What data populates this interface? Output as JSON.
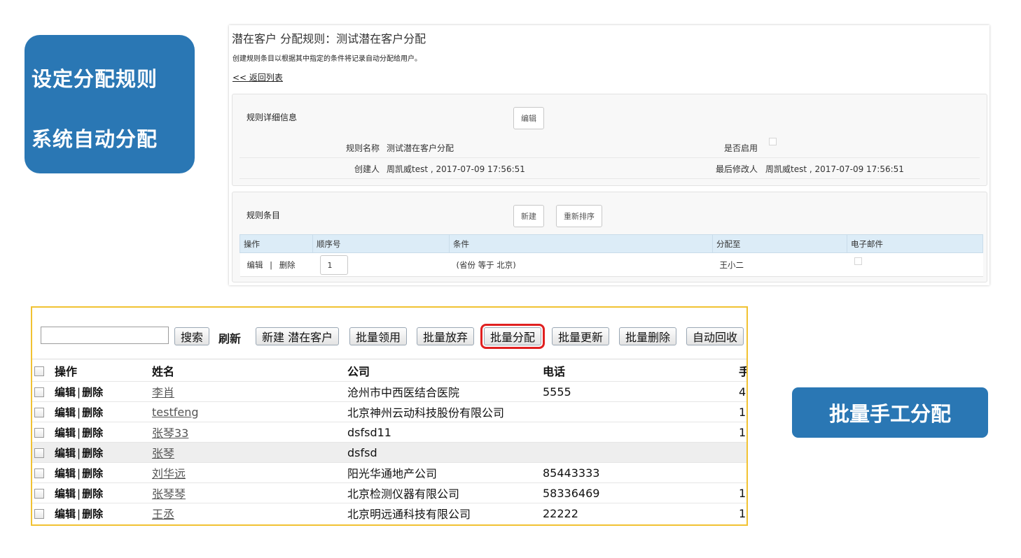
{
  "callouts": {
    "left_line1": "设定分配规则",
    "left_line2": "系统自动分配",
    "right": "批量手工分配"
  },
  "rule": {
    "title": "潜在客户 分配规则：测试潜在客户分配",
    "description": "创建规则条目以根据其中指定的条件将记录自动分配给用户。",
    "back_link": "<< 返回列表",
    "detail_section_title": "规则详细信息",
    "edit_button": "编辑",
    "rule_name_label": "规则名称",
    "rule_name_value": "测试潜在客户分配",
    "enabled_label": "是否启用",
    "created_by_label": "创建人",
    "created_by_value": "周凯威test , 2017-07-09 17:56:51",
    "modified_by_label": "最后修改人",
    "modified_by_value": "周凯威test , 2017-07-09 17:56:51",
    "items_section_title": "规则条目",
    "new_button": "新建",
    "reorder_button": "重新排序",
    "items_columns": [
      "操作",
      "顺序号",
      "条件",
      "分配至",
      "电子邮件"
    ],
    "items": [
      {
        "edit": "编辑",
        "sep": "|",
        "delete": "删除",
        "seq": "1",
        "condition": "(省份 等于 北京)",
        "assignee": "王小二"
      }
    ]
  },
  "list": {
    "search_input_value": "",
    "search_button": "搜索",
    "refresh": "刷新",
    "buttons": {
      "new_lead": "新建 潜在客户",
      "batch_claim": "批量领用",
      "batch_abandon": "批量放弃",
      "batch_assign": "批量分配",
      "batch_update": "批量更新",
      "batch_delete": "批量删除",
      "auto_recycle": "自动回收"
    },
    "columns": {
      "ops": "操作",
      "name": "姓名",
      "company": "公司",
      "phone": "电话",
      "mobile": "手"
    },
    "rows": [
      {
        "edit": "编辑",
        "delete": "删除",
        "name": "李肖",
        "company": "沧州市中西医结合医院",
        "phone": "5555",
        "mobile": "4"
      },
      {
        "edit": "编辑",
        "delete": "删除",
        "name": "testfeng",
        "company": "北京神州云动科技股份有限公司",
        "phone": "",
        "mobile": "1"
      },
      {
        "edit": "编辑",
        "delete": "删除",
        "name": "张琴33",
        "company": "dsfsd11",
        "phone": "",
        "mobile": "1"
      },
      {
        "edit": "编辑",
        "delete": "删除",
        "name": "张琴",
        "company": "dsfsd",
        "phone": "",
        "mobile": ""
      },
      {
        "edit": "编辑",
        "delete": "删除",
        "name": "刘华远",
        "company": "阳光华通地产公司",
        "phone": "85443333",
        "mobile": ""
      },
      {
        "edit": "编辑",
        "delete": "删除",
        "name": "张琴琴",
        "company": "北京检测仪器有限公司",
        "phone": "58336469",
        "mobile": "1"
      },
      {
        "edit": "编辑",
        "delete": "删除",
        "name": "王丞",
        "company": "北京明远通科技有限公司",
        "phone": "22222",
        "mobile": "1"
      }
    ],
    "op_separator": "|"
  }
}
